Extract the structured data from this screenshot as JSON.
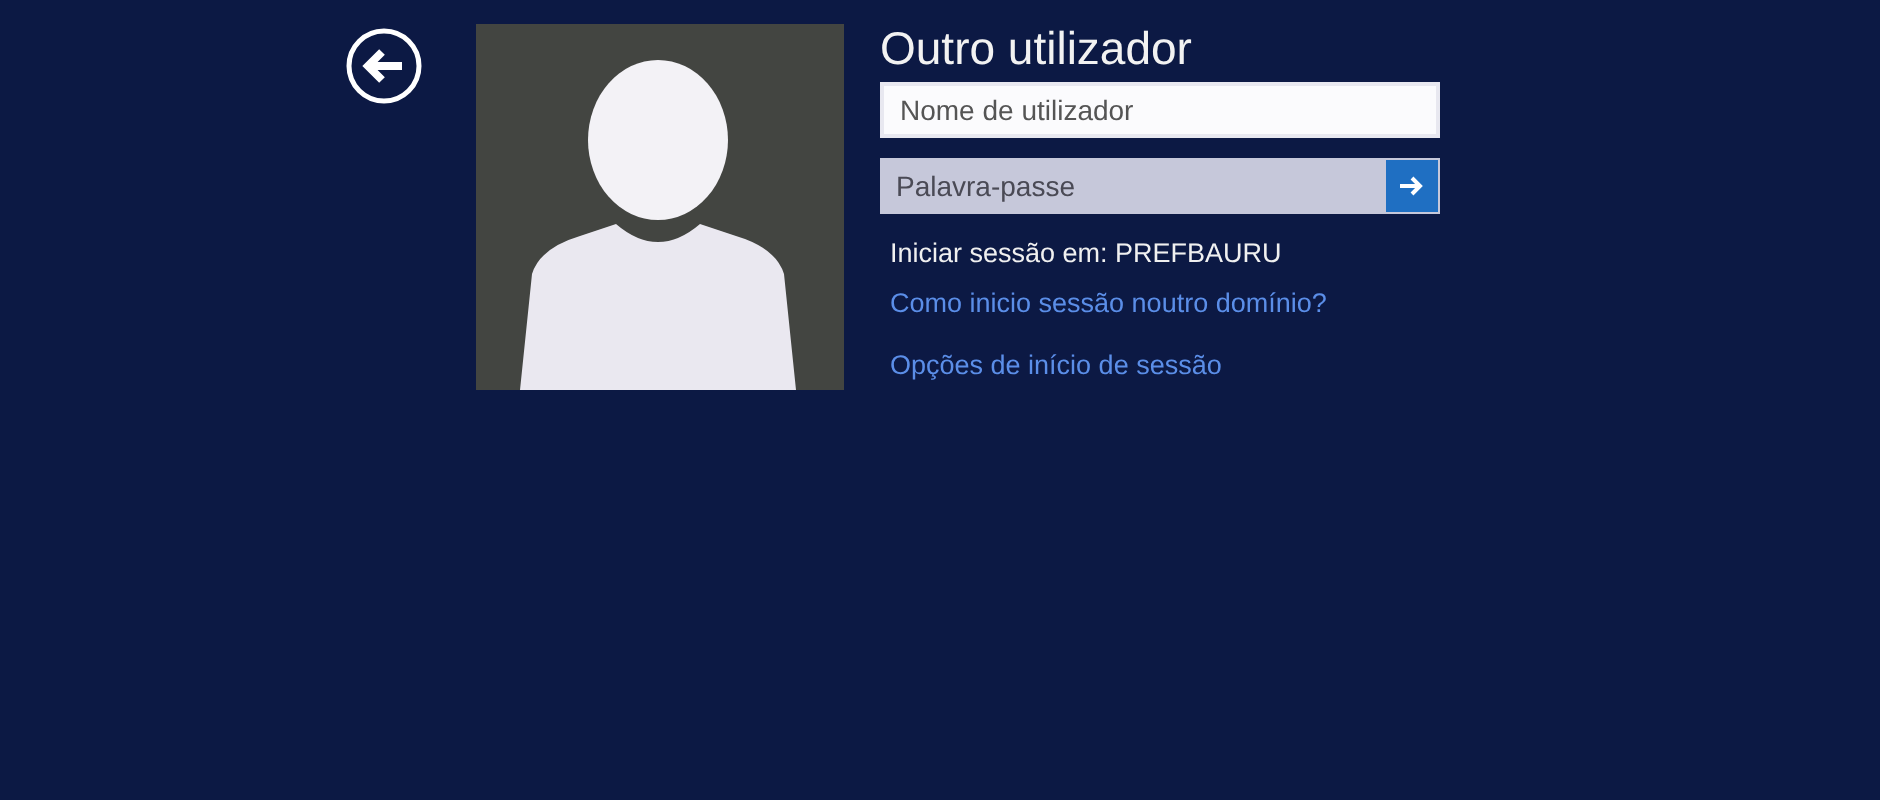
{
  "title": "Outro utilizador",
  "username_field": {
    "placeholder": "Nome de utilizador"
  },
  "password_field": {
    "placeholder": "Palavra-passe"
  },
  "sign_in_to": "Iniciar sessão em: PREFBAURU",
  "links": [
    {
      "label": "Como inicio sessão noutro domínio?"
    },
    {
      "label": "Opções de início de sessão"
    }
  ]
}
